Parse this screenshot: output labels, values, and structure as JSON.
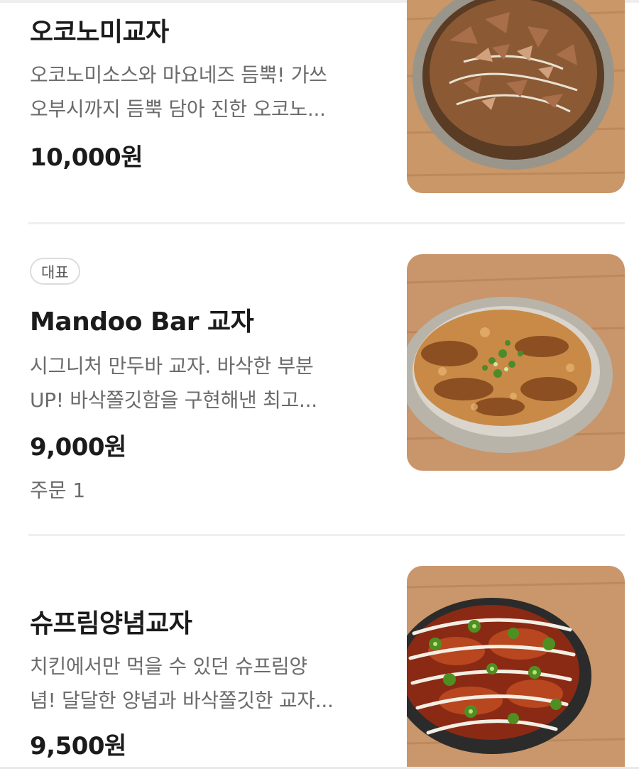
{
  "menu_items": [
    {
      "name": "오코노미교자",
      "description_lines": [
        "오코노미소스와 마요네즈 듬뿍! 가쓰",
        "오부시까지 듬뿍 담아 진한 오코노..."
      ],
      "price": "10,000원",
      "image": "okonomi-gyoza-photo"
    },
    {
      "badge": "대표",
      "name": "Mandoo Bar 교자",
      "description_lines": [
        "시그니처 만두바 교자. 바삭한 부분",
        "UP! 바삭쫄깃함을 구현해낸 최고..."
      ],
      "price": "9,000원",
      "orders": "주문 1",
      "image": "mandoo-bar-gyoza-photo"
    },
    {
      "name": "슈프림양념교자",
      "description_lines": [
        "치킨에서만 먹을 수 있던 슈프림양",
        "념! 달달한 양념과 바삭쫄깃한 교자..."
      ],
      "price": "9,500원",
      "image": "supreme-yangnyeom-gyoza-photo"
    }
  ],
  "colors": {
    "text_primary": "#1b1b1b",
    "text_secondary": "#6b6b6b",
    "divider": "#efefef",
    "wood": "#c99768"
  }
}
